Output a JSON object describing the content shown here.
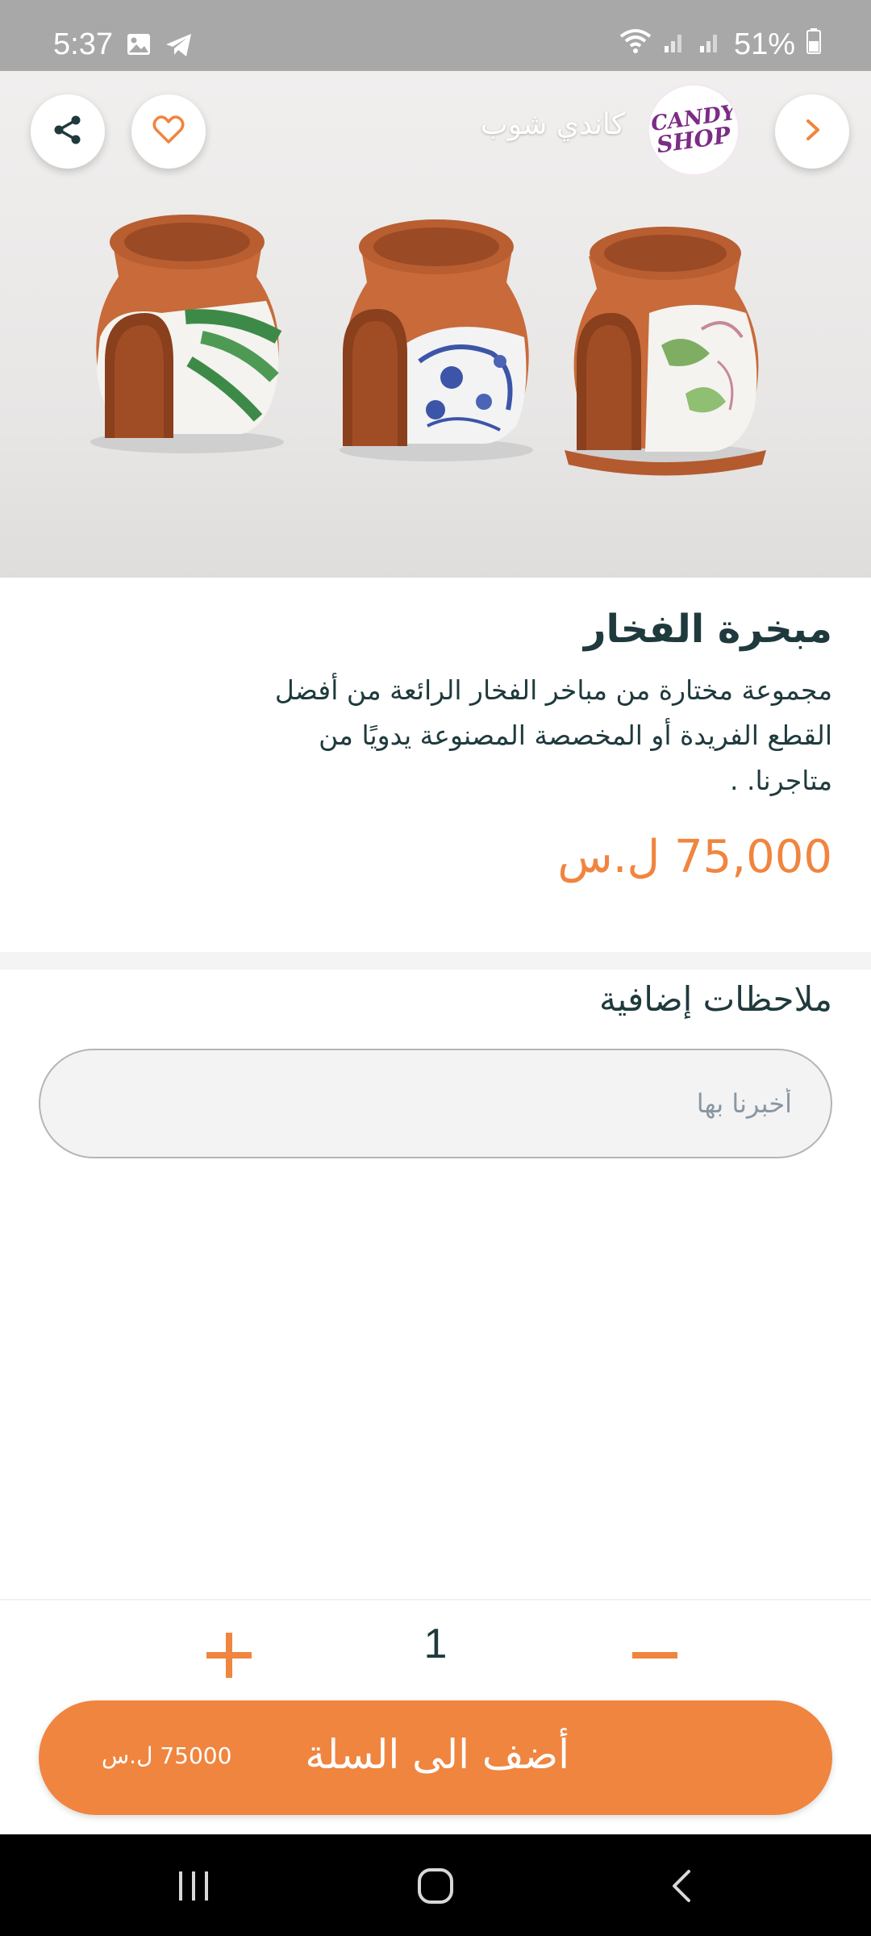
{
  "status": {
    "time": "5:37",
    "battery": "51%",
    "icons": [
      "image-icon",
      "telegram-icon",
      "wifi-icon",
      "signal-icon",
      "signal-icon",
      "battery-icon"
    ]
  },
  "header": {
    "shop_name": "كاندي شوب",
    "logo_line1": "CANDY",
    "logo_line2": "SHOP"
  },
  "product": {
    "title": "مبخرة الفخار",
    "description": "مجموعة مختارة من مباخر الفخار الرائعة من أفضل القطع الفريدة أو المخصصة المصنوعة يدويًا من متاجرنا. .",
    "price_value": "75,000",
    "price_currency": "ل.س"
  },
  "notes": {
    "title": "ملاحظات إضافية",
    "placeholder": "أخبرنا بها"
  },
  "cart": {
    "quantity": "1",
    "button_label": "أضف الى السلة",
    "total": "75000 ل.س"
  },
  "colors": {
    "accent": "#f0853f",
    "text": "#1f3a3d"
  }
}
